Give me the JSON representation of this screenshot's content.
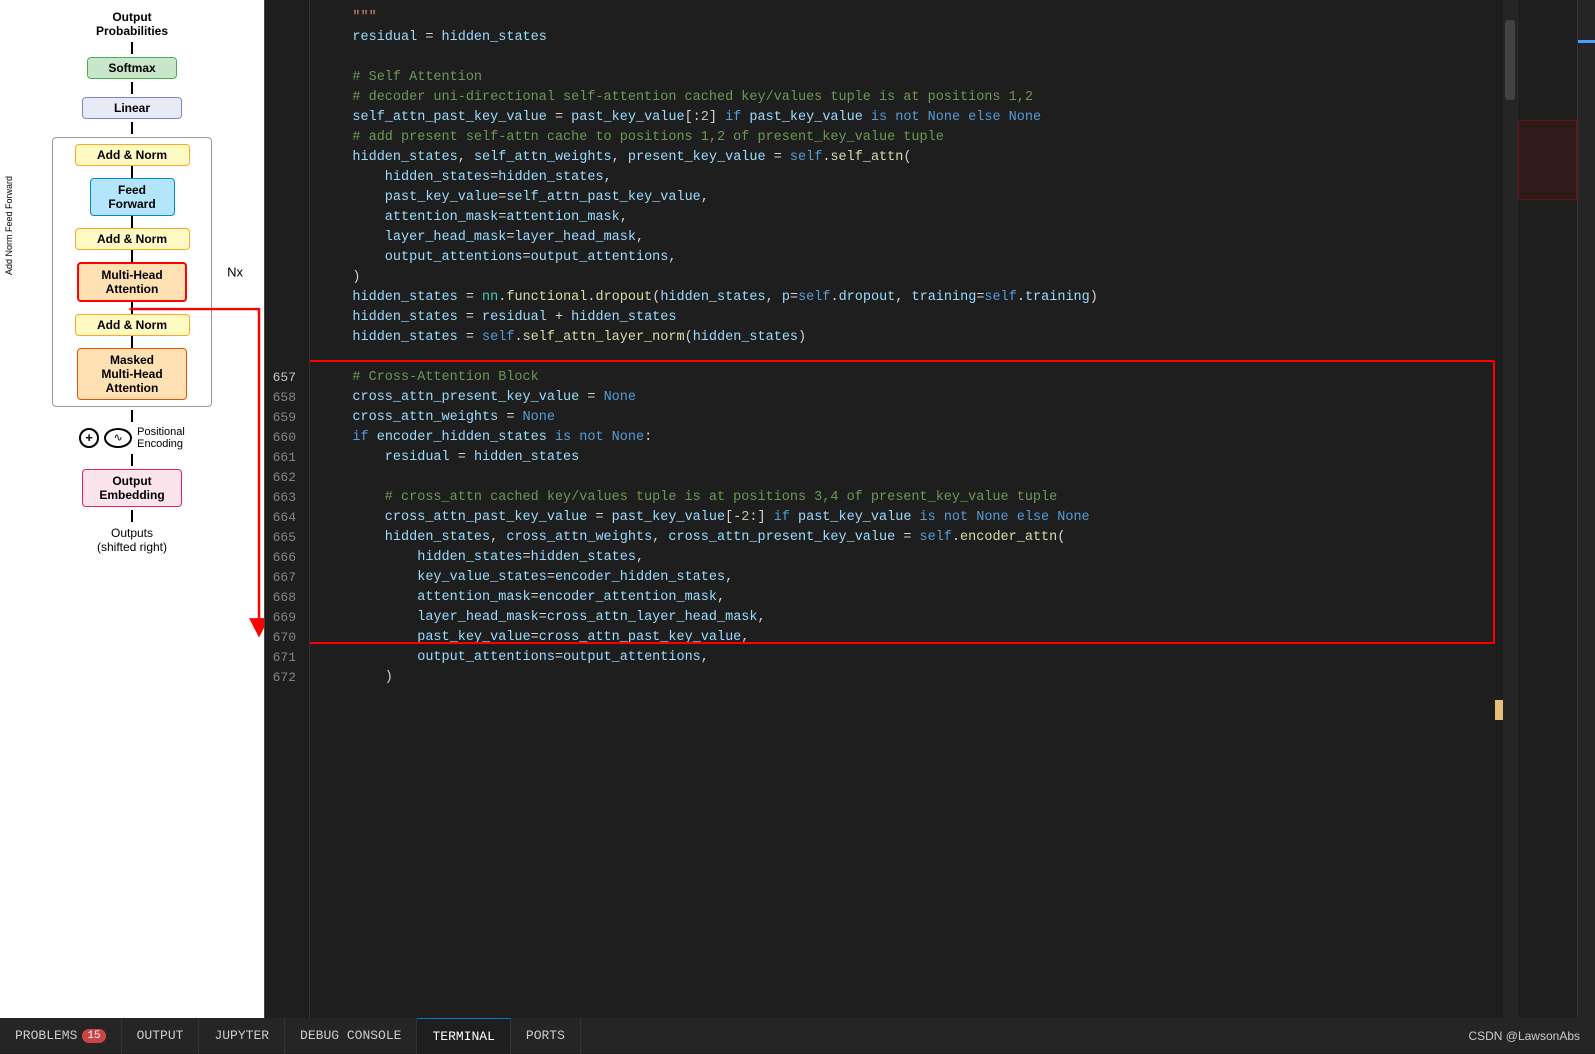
{
  "diagram": {
    "title": "Output\nProbabilities",
    "softmax_label": "Softmax",
    "linear_label": "Linear",
    "add_norm_label": "Add & Norm",
    "feed_forward_label": "Feed\nForward",
    "add_norm2_label": "Add & Norm",
    "multihead_label": "Multi-Head\nAttention",
    "nx_label": "Nx",
    "add_norm3_label": "Add & Norm",
    "masked_label": "Masked\nMulti-Head\nAttention",
    "positional_label": "Positional\nEncoding",
    "output_embed_label": "Output\nEmbedding",
    "outputs_label": "Outputs\n(shifted right)",
    "add_norm_ff_label": "Add Norm Feed Forward"
  },
  "code": {
    "lines": [
      {
        "num": "",
        "text": "    \"\"\"",
        "type": "string"
      },
      {
        "num": "",
        "text": "    residual = hidden_states",
        "type": "code"
      },
      {
        "num": "",
        "text": "",
        "type": "empty"
      },
      {
        "num": "",
        "text": "    # Self Attention",
        "type": "comment"
      },
      {
        "num": "",
        "text": "    # decoder uni-directional self-attention cached key/values tuple is at positions 1,2",
        "type": "comment"
      },
      {
        "num": "",
        "text": "    self_attn_past_key_value = past_key_value[:2] if past_key_value is not None else None",
        "type": "code"
      },
      {
        "num": "",
        "text": "    # add present self-attn cache to positions 1,2 of present_key_value tuple",
        "type": "comment"
      },
      {
        "num": "",
        "text": "    hidden_states, self_attn_weights, present_key_value = self.self_attn(",
        "type": "code"
      },
      {
        "num": "",
        "text": "        hidden_states=hidden_states,",
        "type": "code"
      },
      {
        "num": "",
        "text": "        past_key_value=self_attn_past_key_value,",
        "type": "code"
      },
      {
        "num": "",
        "text": "        attention_mask=attention_mask,",
        "type": "code"
      },
      {
        "num": "",
        "text": "        layer_head_mask=layer_head_mask,",
        "type": "code"
      },
      {
        "num": "",
        "text": "        output_attentions=output_attentions,",
        "type": "code"
      },
      {
        "num": "",
        "text": "    )",
        "type": "code"
      },
      {
        "num": "",
        "text": "    hidden_states = nn.functional.dropout(hidden_states, p=self.dropout, training=self.training)",
        "type": "code"
      },
      {
        "num": "",
        "text": "    hidden_states = residual + hidden_states",
        "type": "code"
      },
      {
        "num": "",
        "text": "    hidden_states = self.self_attn_layer_norm(hidden_states)",
        "type": "code"
      },
      {
        "num": "",
        "text": "",
        "type": "empty"
      },
      {
        "num": "657",
        "text": "    # Cross-Attention Block",
        "type": "comment_highlight"
      },
      {
        "num": "658",
        "text": "    cross_attn_present_key_value = None",
        "type": "code"
      },
      {
        "num": "659",
        "text": "    cross_attn_weights = None",
        "type": "code"
      },
      {
        "num": "660",
        "text": "    if encoder_hidden_states is not None:",
        "type": "code"
      },
      {
        "num": "661",
        "text": "        residual = hidden_states",
        "type": "code"
      },
      {
        "num": "662",
        "text": "",
        "type": "empty"
      },
      {
        "num": "663",
        "text": "        # cross_attn cached key/values tuple is at positions 3,4 of present_key_value tuple",
        "type": "comment"
      },
      {
        "num": "664",
        "text": "        cross_attn_past_key_value = past_key_value[-2:] if past_key_value is not None else None",
        "type": "code"
      }
    ],
    "line_numbers": [
      "",
      "",
      "",
      "",
      "",
      "",
      "",
      "",
      "",
      "",
      "",
      "",
      "",
      "",
      "",
      "",
      "",
      "",
      "657",
      "658",
      "659",
      "660",
      "661",
      "662",
      "663",
      "664"
    ]
  },
  "bottom_tabs": {
    "tabs": [
      "PROBLEMS",
      "OUTPUT",
      "JUPYTER",
      "DEBUG CONSOLE",
      "TERMINAL",
      "PORTS"
    ]
  },
  "status": {
    "problems_count": "15",
    "csdn_label": "CSDN @LawsonAbs"
  }
}
